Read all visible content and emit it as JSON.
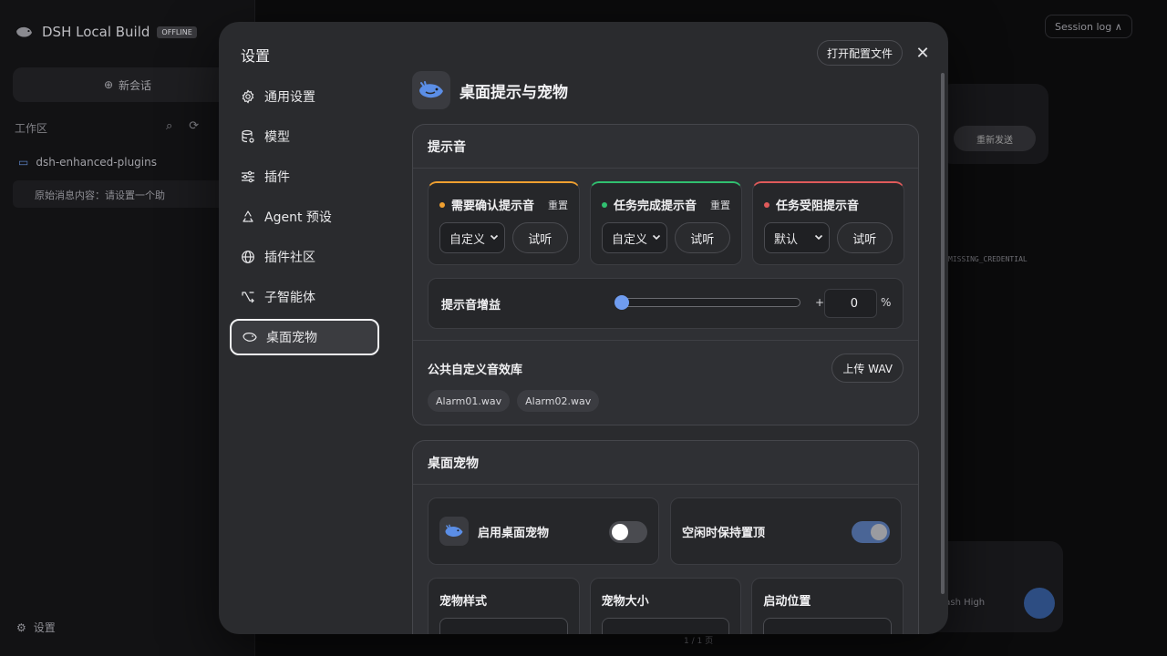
{
  "background": {
    "brand": "DSH Local Build",
    "badge": "OFFLINE",
    "new_chat": "新会话",
    "workspace": "工作区",
    "folder": "dsh-enhanced-plugins",
    "session": "原始消息内容：请设置一个助",
    "settings": "设置",
    "session_log": "Session log",
    "reconnect": "重新发送",
    "credential": "MISSING_CREDENTIAL",
    "model": "flash  High",
    "pager": "1 / 1 页"
  },
  "modal": {
    "title": "设置",
    "open_config": "打开配置文件",
    "close": "✕"
  },
  "nav": [
    {
      "label": "通用设置",
      "icon": "gear-icon"
    },
    {
      "label": "模型",
      "icon": "database-icon"
    },
    {
      "label": "插件",
      "icon": "sliders-icon"
    },
    {
      "label": "Agent 预设",
      "icon": "recycle-icon"
    },
    {
      "label": "插件社区",
      "icon": "globe-icon"
    },
    {
      "label": "子智能体",
      "icon": "branch-icon"
    },
    {
      "label": "桌面宠物",
      "icon": "whale-icon",
      "active": true
    }
  ],
  "page": {
    "title": "桌面提示与宠物"
  },
  "sound_section": {
    "title": "提示音",
    "cards": [
      {
        "title": "需要确认提示音",
        "reset": "重置",
        "select": "自定义",
        "listen": "试听",
        "color": "#f0a030"
      },
      {
        "title": "任务完成提示音",
        "reset": "重置",
        "select": "自定义",
        "listen": "试听",
        "color": "#30c070"
      },
      {
        "title": "任务受阻提示音",
        "reset": "",
        "select": "默认",
        "listen": "试听",
        "color": "#e05a5a"
      }
    ],
    "gain": {
      "label": "提示音增益",
      "value": "0",
      "plus": "+",
      "unit": "%",
      "level": 0
    },
    "library": {
      "title": "公共自定义音效库",
      "upload": "上传 WAV",
      "files": [
        "Alarm01.wav",
        "Alarm02.wav"
      ]
    }
  },
  "pet_section": {
    "title": "桌面宠物",
    "enable_label": "启用桌面宠物",
    "enable_on": false,
    "keep_top_label": "空闲时保持置顶",
    "keep_top_on": true,
    "options": [
      "宠物样式",
      "宠物大小",
      "启动位置"
    ]
  },
  "colors": {
    "accent": "#6f9cf0",
    "toggle_on": "#4a6596",
    "warning": "#f0a030",
    "success": "#30c070",
    "danger": "#e05a5a"
  }
}
